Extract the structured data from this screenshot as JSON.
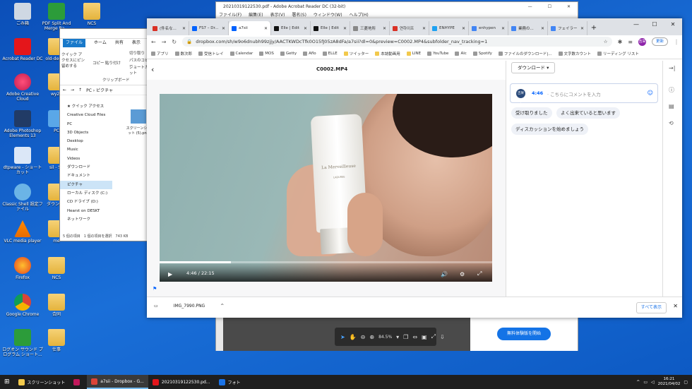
{
  "desktop": {
    "icons": [
      {
        "label": "ごみ箱",
        "type": "recycle"
      },
      {
        "label": "PDF Split And Merge Ba...",
        "type": "green"
      },
      {
        "label": "NCS",
        "type": "folder"
      },
      {
        "label": "Acrobat Reader DC",
        "type": "pdf"
      },
      {
        "label": "old-desk...",
        "type": "folder"
      },
      {
        "label": "Adobe Creative Cloud",
        "type": "cc"
      },
      {
        "label": "wy2..",
        "type": "folder"
      },
      {
        "label": "Adobe Photoshop Elements 13",
        "type": "ps"
      },
      {
        "label": "PC",
        "type": "pc"
      },
      {
        "label": "dtpware - ショートカット",
        "type": "outline"
      },
      {
        "label": "sil - S..",
        "type": "folder"
      },
      {
        "label": "Classic Shell 設定ファイル",
        "type": "person"
      },
      {
        "label": "ダウンロ..",
        "type": "folder"
      },
      {
        "label": "VLC media player",
        "type": "vlc"
      },
      {
        "label": "me",
        "type": "folder"
      },
      {
        "label": "Firefox",
        "type": "ff"
      },
      {
        "label": "NCS",
        "type": "folder"
      },
      {
        "label": "Google Chrome",
        "type": "gc"
      },
      {
        "label": "合同",
        "type": "folder"
      },
      {
        "label": "ログオン サウンド プログラム ショート...",
        "type": "green"
      },
      {
        "label": "仕事",
        "type": "folder"
      }
    ]
  },
  "explorer": {
    "ribbon_tabs": [
      "ファイル",
      "ホーム",
      "共有",
      "表示"
    ],
    "tools": [
      "クイック アクセスにピン留めする",
      "コピー",
      "貼り付け",
      "切り取り",
      "パスのコピー",
      "ショートカット"
    ],
    "clipboard_label": "クリップボード",
    "path": "PC › ピクチャ",
    "nav": [
      {
        "label": "★ クイック アクセス",
        "selected": false
      },
      {
        "label": "Creative Cloud Files",
        "selected": false
      },
      {
        "label": "PC",
        "selected": false
      },
      {
        "label": "3D Objects",
        "selected": false
      },
      {
        "label": "Desktop",
        "selected": false
      },
      {
        "label": "Music",
        "selected": false
      },
      {
        "label": "Videos",
        "selected": false
      },
      {
        "label": "ダウンロード",
        "selected": false
      },
      {
        "label": "ドキュメント",
        "selected": false
      },
      {
        "label": "ピクチャ",
        "selected": true
      },
      {
        "label": "ローカル ディスク (C:)",
        "selected": false
      },
      {
        "label": "CD ドライブ (D:)",
        "selected": false
      },
      {
        "label": "Hearst on DESKT",
        "selected": false
      },
      {
        "label": "ネットワーク",
        "selected": false
      }
    ],
    "file_label": "スクリーンショット (5).png",
    "status": "5 個の項目　1 個の項目を選択　743 KB"
  },
  "acrobat": {
    "title": "20210319122530.pdf - Adobe Acrobat Reader DC (32-bit)",
    "window_controls": [
      "—",
      "☐",
      "✕"
    ],
    "menu": [
      "ファイル(F)",
      "編集(E)",
      "表示(V)",
      "署名(S)",
      "ウィンドウ(W)",
      "ヘルプ(H)"
    ],
    "zoom": "84.5%",
    "cta": "無料体験版を開始"
  },
  "chrome": {
    "tabs": [
      {
        "label": "(件名な...",
        "color": "#d93025",
        "active": false
      },
      {
        "label": "FS7 – Dr...",
        "color": "#0061fe",
        "active": false
      },
      {
        "label": "a7sii",
        "color": "#0061fe",
        "active": true
      },
      {
        "label": "Elle | Edit",
        "color": "#111111",
        "active": false
      },
      {
        "label": "Elle | Edit",
        "color": "#111111",
        "active": false
      },
      {
        "label": "三菱地所",
        "color": "#888888",
        "active": false
      },
      {
        "label": "연하이프",
        "color": "#d93025",
        "active": false
      },
      {
        "label": "ENHYPE",
        "color": "#1da1f2",
        "active": false
      },
      {
        "label": "enhypen",
        "color": "#4285f4",
        "active": false
      },
      {
        "label": "業務の...",
        "color": "#4285f4",
        "active": false
      },
      {
        "label": "フェイラー",
        "color": "#4285f4",
        "active": false
      }
    ],
    "new_tab": "+",
    "window_controls": [
      "—",
      "☐",
      "✕"
    ],
    "url": "dropbox.com/sh/w9o6dnubh99zjjy/AACTKWDcTfk0O15fJ05zA8dFa/a7sii?dl=0&preview=C0002.MP4&subfolder_nav_tracking=1",
    "avatar": "吉栄",
    "update_label": "更新",
    "bookmarks": [
      {
        "label": "アプリ",
        "folder": false
      },
      {
        "label": "数次郎",
        "folder": false
      },
      {
        "label": "受信トレイ",
        "folder": false
      },
      {
        "label": "Calendar",
        "folder": false
      },
      {
        "label": "MOS",
        "folder": false
      },
      {
        "label": "Getty",
        "folder": false
      },
      {
        "label": "Aflo",
        "folder": false
      },
      {
        "label": "ELLE",
        "folder": false
      },
      {
        "label": "ツイッター",
        "folder": true
      },
      {
        "label": "本誌動画用",
        "folder": true
      },
      {
        "label": "LINE",
        "folder": true
      },
      {
        "label": "YouTube",
        "folder": false
      },
      {
        "label": "Alc",
        "folder": false
      },
      {
        "label": "Spotify",
        "folder": false
      },
      {
        "label": "ファイルのダウンロード|...",
        "folder": false
      },
      {
        "label": "文字数カウント",
        "folder": false
      },
      {
        "label": "リーディング リスト",
        "folder": false
      }
    ]
  },
  "dropbox": {
    "file_title": "C0002.MP4",
    "download_label": "ダウンロード ▾",
    "video": {
      "current_time": "4:46",
      "duration": "22:15",
      "progress": 0.214,
      "product_brand": "La Merveilleuse",
      "product_sub": "LADUREE"
    },
    "comment": {
      "avatar": "吉栄 下",
      "timestamp": "4:46",
      "placeholder": "· こちらにコメントを入力"
    },
    "suggestions": [
      "受け取りました",
      "よく出来ていると思います",
      "ディスカッションを始めましょう"
    ]
  },
  "download_bar": {
    "file": "IMG_7990.PNG",
    "show_all": "すべて表示"
  },
  "taskbar": {
    "items": [
      {
        "label": "",
        "color": "#ffffff",
        "active": false
      },
      {
        "label": "スクリーンショット",
        "color": "#f2c94c",
        "active": false
      },
      {
        "label": "",
        "color": "#c2185b",
        "active": false
      },
      {
        "label": "a7sii - Dropbox - G...",
        "color": "#db4437",
        "active": true
      },
      {
        "label": "20210319122530.pd...",
        "color": "#e4161b",
        "active": false
      },
      {
        "label": "フォト",
        "color": "#1a73e8",
        "active": false
      }
    ],
    "time": "16:21",
    "date": "2021/04/02"
  }
}
